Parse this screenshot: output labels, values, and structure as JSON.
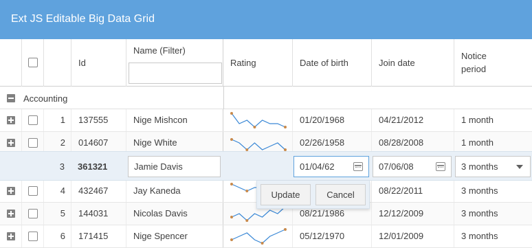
{
  "app": {
    "title": "Ext JS Editable Big Data Grid"
  },
  "columns": {
    "id": "Id",
    "name": "Name (Filter)",
    "rating": "Rating",
    "dob": "Date of birth",
    "join": "Join date",
    "notice_line1": "Notice",
    "notice_line2": "period"
  },
  "group": {
    "label": "Accounting"
  },
  "rows": [
    {
      "num": "1",
      "id": "137555",
      "name": "Nige Mishcon",
      "dob": "01/20/1968",
      "join": "04/21/2012",
      "notice": "1 month",
      "rating": [
        5,
        2,
        3,
        1,
        3,
        2,
        2,
        1
      ]
    },
    {
      "num": "2",
      "id": "014607",
      "name": "Nige White",
      "dob": "02/26/1958",
      "join": "08/28/2008",
      "notice": "1 month",
      "rating": [
        4,
        3,
        1,
        3,
        1,
        2,
        3,
        1
      ]
    },
    {
      "num": "4",
      "id": "432467",
      "name": "Jay Kaneda",
      "dob": "",
      "join": "08/22/2011",
      "notice": "3 months",
      "rating": [
        5,
        4,
        3,
        4,
        4,
        3,
        4,
        3
      ]
    },
    {
      "num": "5",
      "id": "144031",
      "name": "Nicolas Davis",
      "dob": "08/21/1986",
      "join": "12/12/2009",
      "notice": "3 months",
      "rating": [
        2,
        3,
        1,
        3,
        2,
        4,
        3,
        5
      ]
    },
    {
      "num": "6",
      "id": "171415",
      "name": "Nige Spencer",
      "dob": "05/12/1970",
      "join": "12/01/2009",
      "notice": "3 months",
      "rating": [
        2,
        3,
        4,
        2,
        1,
        3,
        4,
        5
      ]
    }
  ],
  "editor": {
    "num": "3",
    "id": "361321",
    "name": "Jamie Davis",
    "dob": "01/04/62",
    "join": "07/06/08",
    "notice": "3 months",
    "update_label": "Update",
    "cancel_label": "Cancel"
  },
  "colors": {
    "header": "#5fa2dd",
    "sparkline": "#3a88d6",
    "spark_point": "#c98a4b"
  },
  "icons": {
    "collapse": "minus-square-icon",
    "expand": "plus-square-icon",
    "calendar": "calendar-icon",
    "dropdown": "chevron-down-icon"
  }
}
